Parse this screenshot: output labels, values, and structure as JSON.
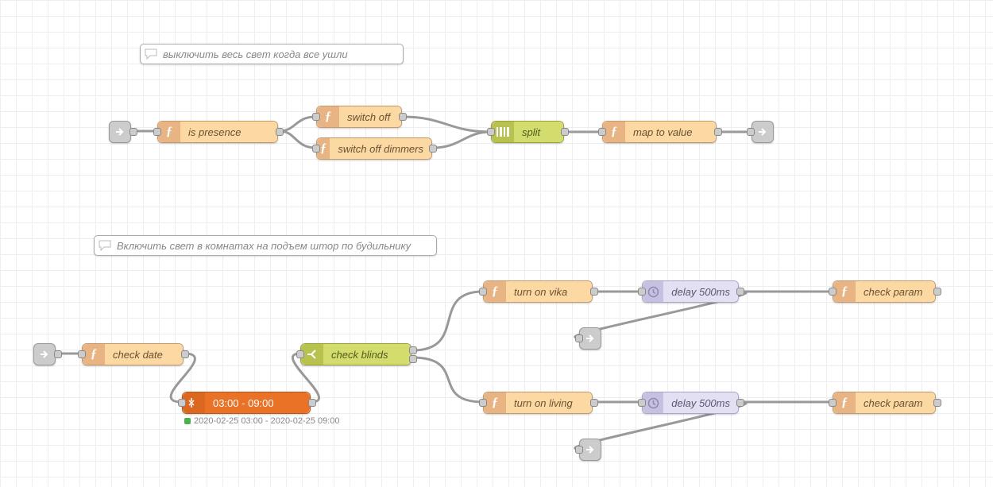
{
  "comments": {
    "c1": "выключить весь свет когда все ушли",
    "c2": "Включить свет в комнатах на подъем штор по будильнику"
  },
  "nodes": {
    "is_presence": "is presence",
    "switch_off": "switch off",
    "switch_off_dimmers": "switch off dimmers",
    "split": "split",
    "map_to_value": "map to value",
    "check_date": "check date",
    "time_range": "03:00 - 09:00",
    "check_blinds": "check blinds",
    "turn_on_vika": "turn on vika",
    "turn_on_living": "turn on living",
    "delay_top": "delay 500ms",
    "delay_bottom": "delay 500ms",
    "check_param_top": "check param",
    "check_param_bottom": "check param"
  },
  "status": {
    "time_range": "2020-02-25 03:00 - 2020-02-25 09:00"
  }
}
